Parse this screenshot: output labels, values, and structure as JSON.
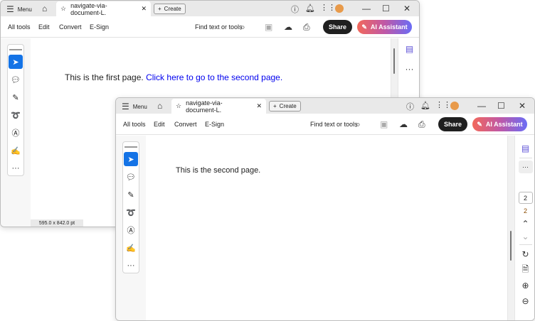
{
  "windows": [
    {
      "menu": "Menu",
      "tab_title": "navigate-via-document-L.",
      "create": "Create",
      "toolbar": {
        "all_tools": "All tools",
        "edit": "Edit",
        "convert": "Convert",
        "esign": "E-Sign",
        "find": "Find text or tools",
        "share": "Share",
        "ai": "AI Assistant"
      },
      "page_text": "This is the first page.",
      "page_link": "Click here to go to the second page.",
      "status": "595.0 x 842.0 pt"
    },
    {
      "menu": "Menu",
      "tab_title": "navigate-via-document-L.",
      "create": "Create",
      "toolbar": {
        "all_tools": "All tools",
        "edit": "Edit",
        "convert": "Convert",
        "esign": "E-Sign",
        "find": "Find text or tools",
        "share": "Share",
        "ai": "AI Assistant"
      },
      "page_text": "This is the second page.",
      "page_input": "2",
      "page_count": "2"
    }
  ],
  "icons": {
    "more": "···",
    "minimize": "—",
    "maximize": "☐",
    "close": "✕"
  },
  "colors": {
    "accent": "#1473e6",
    "link": "#0000ee"
  }
}
